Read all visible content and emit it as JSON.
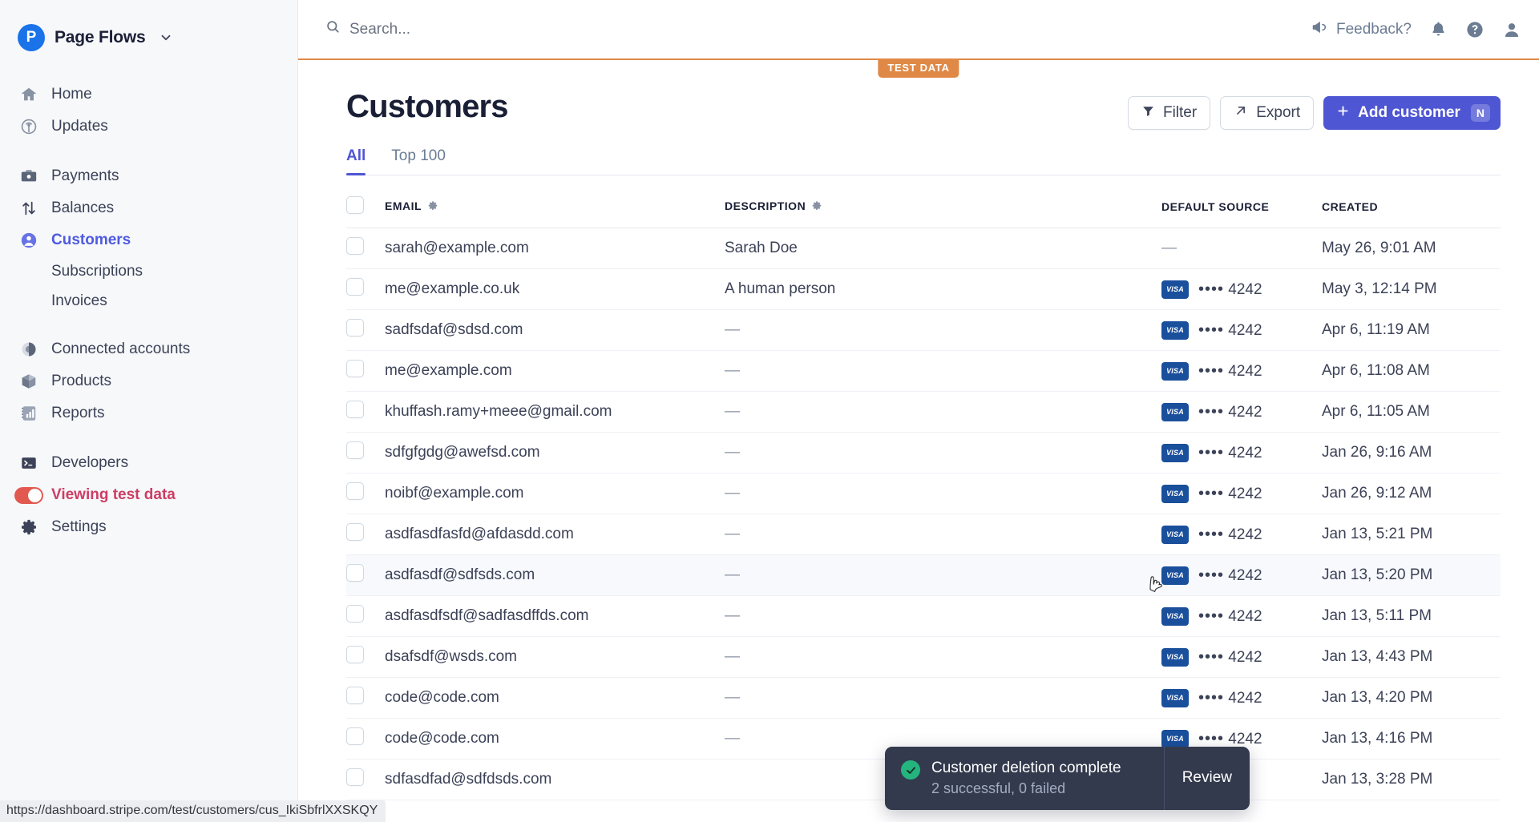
{
  "sidebar": {
    "brand": {
      "logo_letter": "P",
      "name": "Page Flows",
      "caret_icon": "chevron-down-icon"
    },
    "groups": [
      {
        "items": [
          {
            "label": "Home",
            "icon": "home-icon",
            "active": false
          },
          {
            "label": "Updates",
            "icon": "broadcast-icon",
            "active": false
          }
        ]
      },
      {
        "items": [
          {
            "label": "Payments",
            "icon": "payments-icon",
            "active": false
          },
          {
            "label": "Balances",
            "icon": "balances-icon",
            "active": false
          },
          {
            "label": "Customers",
            "icon": "customers-icon",
            "active": true
          }
        ],
        "subitems": [
          {
            "label": "Subscriptions"
          },
          {
            "label": "Invoices"
          }
        ]
      },
      {
        "items": [
          {
            "label": "Connected accounts",
            "icon": "connected-accounts-icon",
            "active": false
          },
          {
            "label": "Products",
            "icon": "products-icon",
            "active": false
          },
          {
            "label": "Reports",
            "icon": "reports-icon",
            "active": false
          }
        ]
      },
      {
        "items": [
          {
            "label": "Developers",
            "icon": "developers-icon",
            "active": false
          }
        ]
      }
    ],
    "test_data_toggle": {
      "label": "Viewing test data",
      "on": true,
      "color": "#e25950"
    },
    "settings": {
      "label": "Settings",
      "icon": "gear-icon"
    }
  },
  "topbar": {
    "search": {
      "placeholder": "Search...",
      "value": "",
      "icon": "search-icon"
    },
    "feedback": {
      "label": "Feedback?",
      "icon": "megaphone-icon"
    },
    "notifications_icon": "bell-icon",
    "help_icon": "question-circle-icon",
    "account_icon": "user-avatar-icon",
    "test_badge": "TEST DATA",
    "accent_color": "#e08947"
  },
  "page": {
    "title": "Customers",
    "actions": {
      "filter": {
        "label": "Filter",
        "icon": "filter-icon"
      },
      "export": {
        "label": "Export",
        "icon": "arrow-up-right-icon"
      },
      "add_customer": {
        "label": "Add customer",
        "icon": "plus-icon",
        "shortcut": "N",
        "color": "#4f56d3"
      }
    },
    "tabs": [
      {
        "label": "All",
        "active": true
      },
      {
        "label": "Top 100",
        "active": false
      }
    ]
  },
  "table": {
    "columns": [
      {
        "key": "email",
        "label": "EMAIL",
        "gear": true
      },
      {
        "key": "description",
        "label": "DESCRIPTION",
        "gear": true
      },
      {
        "key": "default_source",
        "label": "DEFAULT SOURCE",
        "gear": false
      },
      {
        "key": "created",
        "label": "CREATED",
        "gear": false
      }
    ],
    "rows": [
      {
        "email": "sarah@example.com",
        "description": "Sarah Doe",
        "card_brand": "",
        "card_last4": "",
        "source_dash": "—",
        "created": "May 26, 9:01 AM",
        "hovered": false
      },
      {
        "email": "me@example.co.uk",
        "description": "A human person",
        "card_brand": "VISA",
        "card_last4": "4242",
        "source_dash": "",
        "created": "May 3, 12:14 PM",
        "hovered": false
      },
      {
        "email": "sadfsdaf@sdsd.com",
        "description": "—",
        "card_brand": "VISA",
        "card_last4": "4242",
        "source_dash": "",
        "created": "Apr 6, 11:19 AM",
        "hovered": false
      },
      {
        "email": "me@example.com",
        "description": "—",
        "card_brand": "VISA",
        "card_last4": "4242",
        "source_dash": "",
        "created": "Apr 6, 11:08 AM",
        "hovered": false
      },
      {
        "email": "khuffash.ramy+meee@gmail.com",
        "description": "—",
        "card_brand": "VISA",
        "card_last4": "4242",
        "source_dash": "",
        "created": "Apr 6, 11:05 AM",
        "hovered": false
      },
      {
        "email": "sdfgfgdg@awefsd.com",
        "description": "—",
        "card_brand": "VISA",
        "card_last4": "4242",
        "source_dash": "",
        "created": "Jan 26, 9:16 AM",
        "hovered": false
      },
      {
        "email": "noibf@example.com",
        "description": "—",
        "card_brand": "VISA",
        "card_last4": "4242",
        "source_dash": "",
        "created": "Jan 26, 9:12 AM",
        "hovered": false
      },
      {
        "email": "asdfasdfasfd@afdasdd.com",
        "description": "—",
        "card_brand": "VISA",
        "card_last4": "4242",
        "source_dash": "",
        "created": "Jan 13, 5:21 PM",
        "hovered": false
      },
      {
        "email": "asdfasdf@sdfsds.com",
        "description": "—",
        "card_brand": "VISA",
        "card_last4": "4242",
        "source_dash": "",
        "created": "Jan 13, 5:20 PM",
        "hovered": true
      },
      {
        "email": "asdfasdfsdf@sadfasdffds.com",
        "description": "—",
        "card_brand": "VISA",
        "card_last4": "4242",
        "source_dash": "",
        "created": "Jan 13, 5:11 PM",
        "hovered": false
      },
      {
        "email": "dsafsdf@wsds.com",
        "description": "—",
        "card_brand": "VISA",
        "card_last4": "4242",
        "source_dash": "",
        "created": "Jan 13, 4:43 PM",
        "hovered": false
      },
      {
        "email": "code@code.com",
        "description": "—",
        "card_brand": "VISA",
        "card_last4": "4242",
        "source_dash": "",
        "created": "Jan 13, 4:20 PM",
        "hovered": false
      },
      {
        "email": "code@code.com",
        "description": "—",
        "card_brand": "VISA",
        "card_last4": "4242",
        "source_dash": "",
        "created": "Jan 13, 4:16 PM",
        "hovered": false
      },
      {
        "email": "sdfasdfad@sdfdsds.com",
        "description": "",
        "card_brand": "",
        "card_last4": "",
        "source_dash": "—",
        "created": "Jan 13, 3:28 PM",
        "hovered": false
      }
    ]
  },
  "toast": {
    "status_icon": "check-circle-icon",
    "title": "Customer deletion complete",
    "subtitle": "2 successful, 0 failed",
    "action_label": "Review",
    "success_color": "#24b47e"
  },
  "statusbar": {
    "url": "https://dashboard.stripe.com/test/customers/cus_IkiSbfrlXXSKQY"
  }
}
